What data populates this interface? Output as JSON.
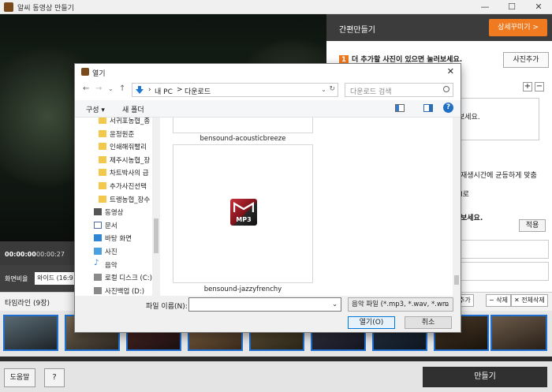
{
  "app": {
    "title": "알씨 동영상 만들기",
    "window_controls": [
      "—",
      "☐",
      "✕"
    ]
  },
  "right_panel": {
    "title": "간편만들기",
    "detail_button": "상세꾸미기 >",
    "step1_num": "1",
    "step1_text": "더 추가할 사진이 있으면 눌러보세요.",
    "add_photo_button": "사진추가",
    "plus": "+",
    "minus": "−",
    "text_fragment_1": "보세요.",
    "text_fragment_2": "재생시간에 균등하게 맞춤",
    "text_fragment_3": "I로",
    "text_fragment_4": "보세요.",
    "apply_button": "적용"
  },
  "player": {
    "current_time": "00:00:00",
    "total_time": "00:00:27",
    "ratio_label": "화면비율",
    "ratio_value": "와이드 (16:9"
  },
  "timeline": {
    "title": "타임라인 (9장)",
    "btn_add": "추가",
    "btn_delete": "− 삭제",
    "btn_delete_all": "✕ 전체삭제"
  },
  "footer": {
    "help_button": "도움말",
    "question_button": "?",
    "make_button": "만들기"
  },
  "dialog": {
    "title": "열기",
    "close": "✕",
    "breadcrumb": [
      "내 PC",
      ">",
      "다운로드"
    ],
    "search_placeholder": "다운로드 검색",
    "organize": "구성 ▾",
    "new_folder": "새 폴더",
    "help": "?",
    "tree_items": [
      {
        "label": "서귀포농협_종",
        "type": "folder"
      },
      {
        "label": "윤정원준",
        "type": "folder"
      },
      {
        "label": "인쇄해줘빨리",
        "type": "folder"
      },
      {
        "label": "제주시농협_장",
        "type": "folder"
      },
      {
        "label": "차트박사의 급",
        "type": "folder"
      },
      {
        "label": "추가사진선택",
        "type": "folder"
      },
      {
        "label": "트랭농협_장수",
        "type": "folder"
      },
      {
        "label": "동영상",
        "type": "video"
      },
      {
        "label": "문서",
        "type": "doc"
      },
      {
        "label": "바탕 화면",
        "type": "desktop"
      },
      {
        "label": "사진",
        "type": "photo"
      },
      {
        "label": "음악",
        "type": "music"
      },
      {
        "label": "로컬 디스크 (C:)",
        "type": "disk"
      },
      {
        "label": "사진백업 (D:)",
        "type": "disk"
      }
    ],
    "files": [
      {
        "name": "bensound-acousticbreeze"
      },
      {
        "name": "bensound-jazzyfrenchy",
        "badge": "MP3"
      }
    ],
    "filename_label": "파일 이름(N):",
    "filename_value": "",
    "filetype_value": "음악 파일 (*.mp3, *.wav, *.wm",
    "open_button": "열기(O)",
    "cancel_button": "취소"
  },
  "colors": {
    "accent_orange": "#f07a1f",
    "select_blue": "#1e6fd0",
    "dark_button": "#303030"
  }
}
